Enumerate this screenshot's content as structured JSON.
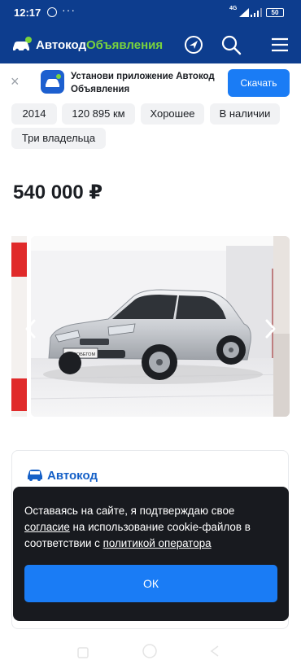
{
  "status_bar": {
    "time": "12:17",
    "dots": "···",
    "network": "4G",
    "battery": "50"
  },
  "header": {
    "brand_main": "Автокод",
    "brand_accent": "Объявления",
    "brand_color": "#0d3d8e",
    "accent_color": "#7ad43c",
    "icons": [
      "car-logo-icon",
      "navigation-arrow-icon",
      "search-icon",
      "menu-icon"
    ]
  },
  "app_banner": {
    "close": "×",
    "text": "Установи приложение Автокод Объявления",
    "button": "Скачать"
  },
  "specs": {
    "chips": [
      "2014",
      "120 895 км",
      "Хорошее",
      "В наличии",
      "Три владельца"
    ]
  },
  "listing": {
    "price": "540 000 ₽"
  },
  "gallery": {
    "plate_text": "С ПРОБЕГОМ",
    "icons": [
      "chevron-left-icon",
      "chevron-right-icon"
    ]
  },
  "seller": {
    "name": "Автокод",
    "icon": "car-icon"
  },
  "cookie_dialog": {
    "text_before": "Оставаясь на сайте, я подтверждаю свое",
    "link_1": "согласие",
    "text_middle": "на использование cookie-файлов в соответствии с",
    "link_2": "политикой оператора",
    "ok_button": "ОК"
  }
}
